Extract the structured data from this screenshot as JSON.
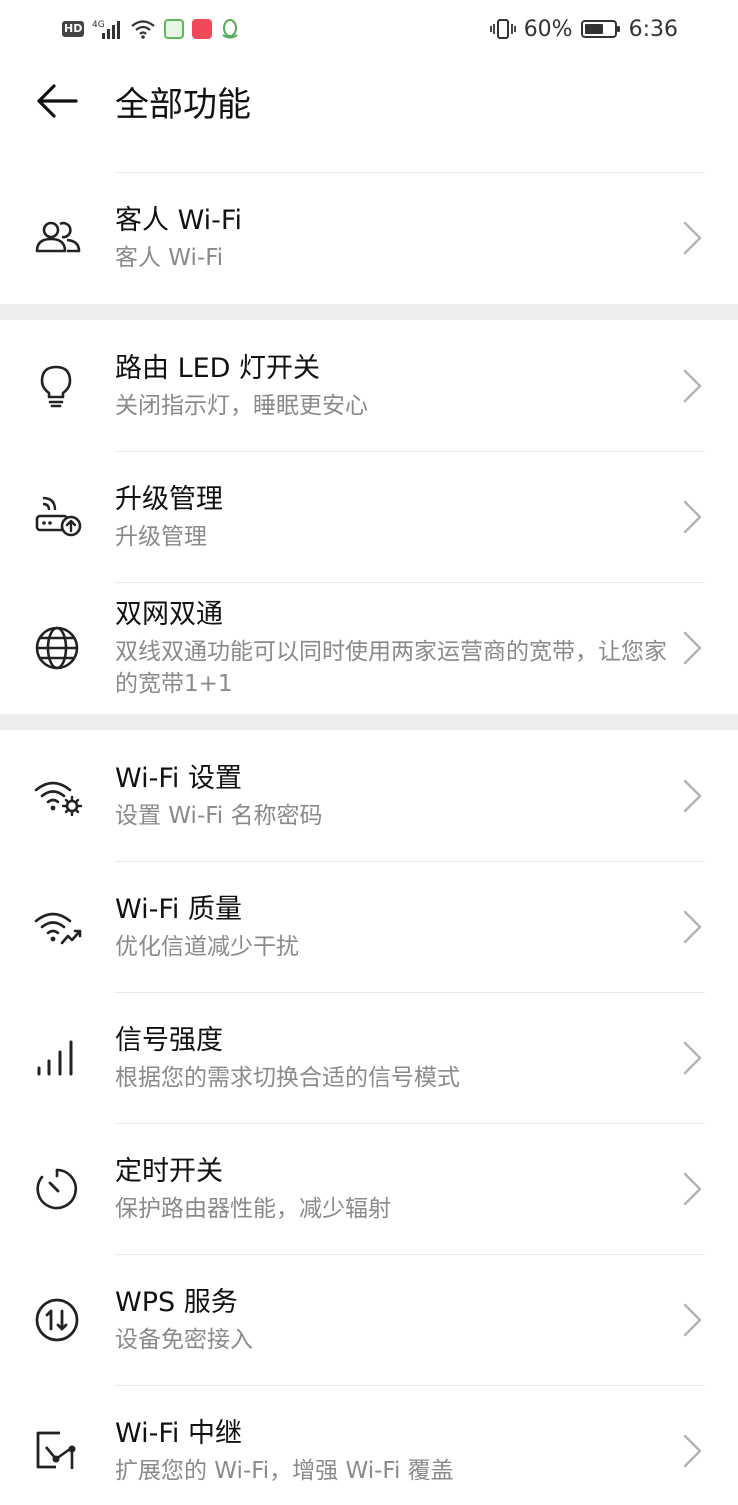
{
  "status_bar": {
    "left_icons": [
      "hd-icon",
      "4g-signal-icon",
      "wifi-icon",
      "app-badge-green-icon",
      "app-badge-red-icon",
      "qq-icon"
    ],
    "network_label": "HD",
    "battery_percent": "60%",
    "time": "6:36"
  },
  "header": {
    "title": "全部功能"
  },
  "items": [
    {
      "title": "客人 Wi-Fi",
      "subtitle": "客人 Wi-Fi",
      "icon": "guest-users-icon"
    },
    {
      "title": "路由 LED 灯开关",
      "subtitle": "关闭指示灯，睡眠更安心",
      "icon": "lightbulb-icon"
    },
    {
      "title": "升级管理",
      "subtitle": "升级管理",
      "icon": "router-upgrade-icon"
    },
    {
      "title": "双网双通",
      "subtitle": "双线双通功能可以同时使用两家运营商的宽带，让您家的宽带1+1",
      "icon": "globe-icon"
    },
    {
      "title": "Wi-Fi 设置",
      "subtitle": "设置 Wi-Fi 名称密码",
      "icon": "wifi-settings-icon"
    },
    {
      "title": "Wi-Fi 质量",
      "subtitle": "优化信道减少干扰",
      "icon": "wifi-quality-icon"
    },
    {
      "title": "信号强度",
      "subtitle": "根据您的需求切换合适的信号模式",
      "icon": "signal-bars-icon"
    },
    {
      "title": "定时开关",
      "subtitle": "保护路由器性能，减少辐射",
      "icon": "timer-icon"
    },
    {
      "title": "WPS 服务",
      "subtitle": "设备免密接入",
      "icon": "wps-icon"
    },
    {
      "title": "Wi-Fi 中继",
      "subtitle": "扩展您的 Wi-Fi，增强 Wi-Fi 覆盖",
      "icon": "wifi-relay-icon"
    }
  ]
}
